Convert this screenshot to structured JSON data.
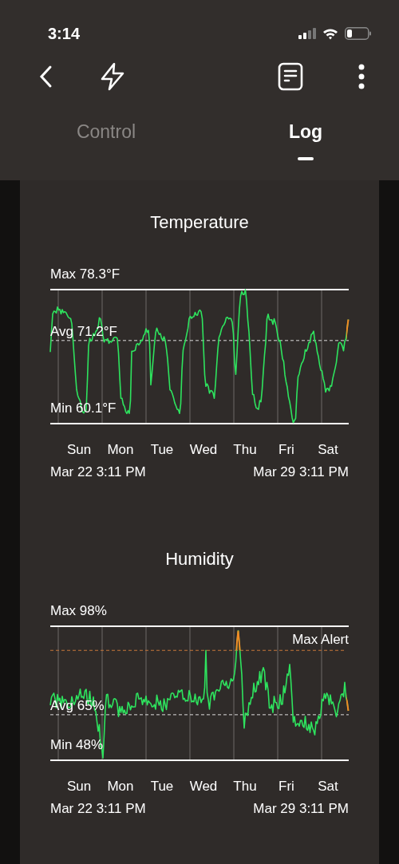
{
  "status_bar": {
    "time": "3:14"
  },
  "tabs": [
    {
      "label": "Control",
      "selected": false
    },
    {
      "label": "Log",
      "selected": true
    }
  ],
  "charts": [
    {
      "kind": "temperature",
      "title": "Temperature",
      "max_label": "Max 78.3°F",
      "avg_label": "Avg 71.2°F",
      "min_label": "Min 60.1°F",
      "days": [
        "Sun",
        "Mon",
        "Tue",
        "Wed",
        "Thu",
        "Fri",
        "Sat"
      ],
      "start": "Mar 22 3:11 PM",
      "end": "Mar 29 3:11 PM"
    },
    {
      "kind": "humidity",
      "title": "Humidity",
      "max_label": "Max 98%",
      "avg_label": "Avg 65%",
      "min_label": "Min 48%",
      "alert_label": "Max Alert",
      "days": [
        "Sun",
        "Mon",
        "Tue",
        "Wed",
        "Thu",
        "Fri",
        "Sat"
      ],
      "start": "Mar 22 3:11 PM",
      "end": "Mar 29 3:11 PM"
    }
  ]
}
